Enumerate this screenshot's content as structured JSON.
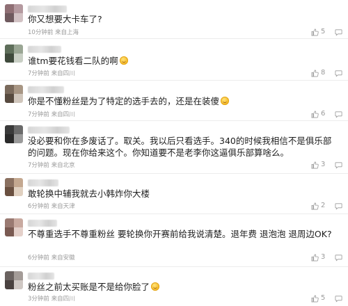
{
  "comments": [
    {
      "text": "你又想要大卡车了?",
      "emoji": false,
      "time": "10分钟前",
      "location": "来自上海",
      "likes": "5",
      "avatar_colors": [
        "#8f6f74",
        "#b59aa0",
        "#6f5a5e",
        "#d2c2c4"
      ]
    },
    {
      "text": "谁tm要花钱看二队的啊",
      "emoji": true,
      "time": "7分钟前",
      "location": "来自四川",
      "likes": "8",
      "avatar_colors": [
        "#5e6e5a",
        "#9aa694",
        "#3f4a3c",
        "#c9cfc5"
      ]
    },
    {
      "text": "你是不懂粉丝是为了特定的选手去的，还是在装傻",
      "emoji": true,
      "time": "7分钟前",
      "location": "来自四川",
      "likes": "6",
      "avatar_colors": [
        "#7a6a5c",
        "#a89684",
        "#574a3f",
        "#d0c6bc"
      ]
    },
    {
      "text": "没必要和你在多废话了。取关。我以后只看选手。340的时候我相信不是俱乐部的问题。现在你给来这个。你知道要不是老李你这逼俱乐部算啥么。",
      "emoji": false,
      "time": "7分钟前",
      "location": "来自北京",
      "likes": "3",
      "avatar_colors": [
        "#3a3a3a",
        "#6a6a6a",
        "#2a2a2a",
        "#9a9a9a"
      ]
    },
    {
      "text": "敢轮换中辅我就去小韩炸你大楼",
      "emoji": false,
      "time": "6分钟前",
      "location": "来自天津",
      "likes": "2",
      "avatar_colors": [
        "#8a7060",
        "#c4a890",
        "#6a5040",
        "#e0d0c0"
      ]
    },
    {
      "text": "不尊重选手不尊重粉丝 要轮换你开赛前给我说清楚。退年费 退泡泡 退周边OK?",
      "emoji": false,
      "time": "6分钟前",
      "location": "来自安徽",
      "likes": "3",
      "avatar_colors": [
        "#9a7a72",
        "#c9aaa0",
        "#7a5a52",
        "#e4d0ca"
      ]
    },
    {
      "text": "粉丝之前太买账是不是给你脸了",
      "emoji": true,
      "time": "3分钟前",
      "location": "来自四川",
      "likes": "5",
      "avatar_colors": [
        "#6a6260",
        "#a49c98",
        "#4a4240",
        "#cfc8c4"
      ]
    }
  ]
}
